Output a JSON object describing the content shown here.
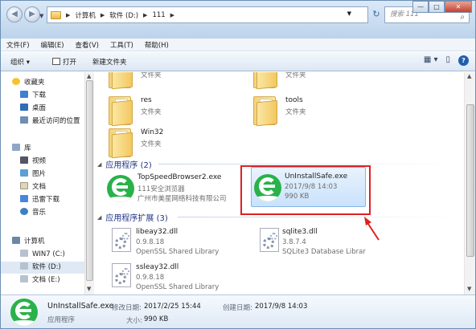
{
  "address": {
    "crumbs": [
      "计算机",
      "软件 (D:)",
      "111"
    ]
  },
  "search": {
    "placeholder": "搜索 111"
  },
  "window": {
    "min": "—",
    "max": "□",
    "close": "✕"
  },
  "menubar": [
    "文件(F)",
    "编辑(E)",
    "查看(V)",
    "工具(T)",
    "帮助(H)"
  ],
  "toolbar": {
    "organize": "组织 ▾",
    "open": "打开",
    "new_folder": "新建文件夹"
  },
  "nav": {
    "favorites": "收藏夹",
    "fav_items": [
      "下载",
      "桌面",
      "最近访问的位置"
    ],
    "libraries": "库",
    "lib_items": [
      "视频",
      "图片",
      "文档",
      "迅雷下载",
      "音乐"
    ],
    "computer": "计算机",
    "comp_items": [
      "WIN7 (C:)",
      "软件 (D:)",
      "文档 (E:)"
    ]
  },
  "folders_top": [
    {
      "name": "",
      "type": "文件夹"
    },
    {
      "name": "",
      "type": "文件夹"
    }
  ],
  "folders": [
    {
      "name": "res",
      "type": "文件夹"
    },
    {
      "name": "tools",
      "type": "文件夹"
    },
    {
      "name": "Win32",
      "type": "文件夹"
    }
  ],
  "groups": {
    "apps": "应用程序 (2)",
    "exts": "应用程序扩展 (3)"
  },
  "apps": [
    {
      "name": "TopSpeedBrowser2.exe",
      "desc": "111安全浏览器",
      "company": "广州市美星网络科技有限公司"
    },
    {
      "name": "UnInstallSafe.exe",
      "date": "2017/9/8 14:03",
      "size": "990 KB"
    }
  ],
  "dlls": [
    {
      "name": "libeay32.dll",
      "version": "0.9.8.18",
      "desc": "OpenSSL Shared Library"
    },
    {
      "name": "sqlite3.dll",
      "version": "3.8.7.4",
      "desc": "SQLite3 Database Librar"
    },
    {
      "name": "ssleay32.dll",
      "version": "0.9.8.18",
      "desc": "OpenSSL Shared Library"
    }
  ],
  "details": {
    "name": "UnInstallSafe.exe",
    "type": "应用程序",
    "mod_label": "修改日期:",
    "mod_value": "2017/2/25 15:44",
    "size_label": "大小:",
    "size_value": "990 KB",
    "created_label": "创建日期:",
    "created_value": "2017/9/8 14:03"
  },
  "colors": {
    "accent": "#1e3287",
    "annotation": "#e02020",
    "app_green": "#29b24a"
  }
}
